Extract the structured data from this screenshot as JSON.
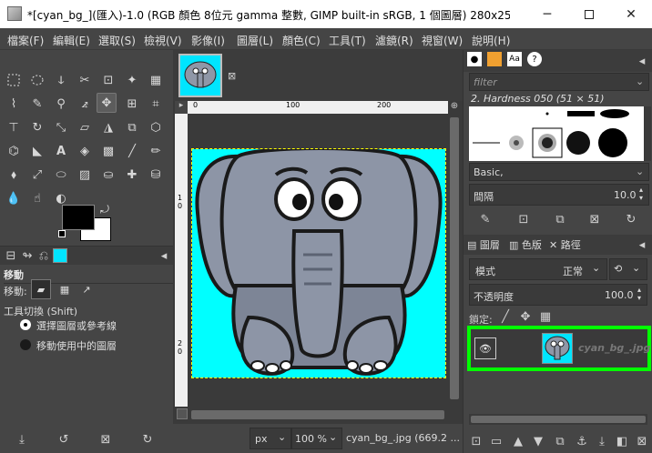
{
  "window": {
    "title": "*[cyan_bg_](匯入)-1.0 (RGB 顏色 8位元 gamma 整數, GIMP built-in sRGB, 1 個圖層) 280x255 – ...",
    "minimize_icon": "minimize-icon",
    "maximize_icon": "maximize-icon",
    "close_icon": "close-icon"
  },
  "menubar": {
    "items": [
      "檔案(F)",
      "編輯(E)",
      "選取(S)",
      "檢視(V)",
      "影像(I)",
      "圖層(L)",
      "顏色(C)",
      "工具(T)",
      "濾鏡(R)",
      "視窗(W)",
      "說明(H)"
    ]
  },
  "tool_options": {
    "tab_icons": [
      "tool-options-icon",
      "device-status-icon",
      "undo-history-icon",
      "images-icon"
    ],
    "title": "移動",
    "move_label": "移動:",
    "tool_toggle_label": "工具切換 (Shift)",
    "radio_options": [
      "選擇圖層或參考線",
      "移動使用中的圖層"
    ],
    "selected_radio": 0
  },
  "canvas": {
    "ruler_top_ticks": [
      "0",
      "100",
      "200"
    ],
    "ruler_left_ticks": [
      "1",
      "0",
      "2",
      "0"
    ],
    "background_color": "#00ffff"
  },
  "statusbar": {
    "unit": "px",
    "zoom": "100 %",
    "filename": "cyan_bg_.jpg (669.2 ..."
  },
  "brushes": {
    "filter_placeholder": "filter",
    "brush_name": "2. Hardness 050 (51 × 51)",
    "preset": "Basic,",
    "spacing_label": "間隔",
    "spacing_value": "10.0"
  },
  "layers": {
    "tabs": [
      "圖層",
      "色版",
      "路徑"
    ],
    "mode_label": "模式",
    "mode_value": "正常",
    "opacity_label": "不透明度",
    "opacity_value": "100.0",
    "lock_label": "鎖定:",
    "layer_name": "cyan_bg_.jpg",
    "highlight_color": "#00ff00"
  }
}
